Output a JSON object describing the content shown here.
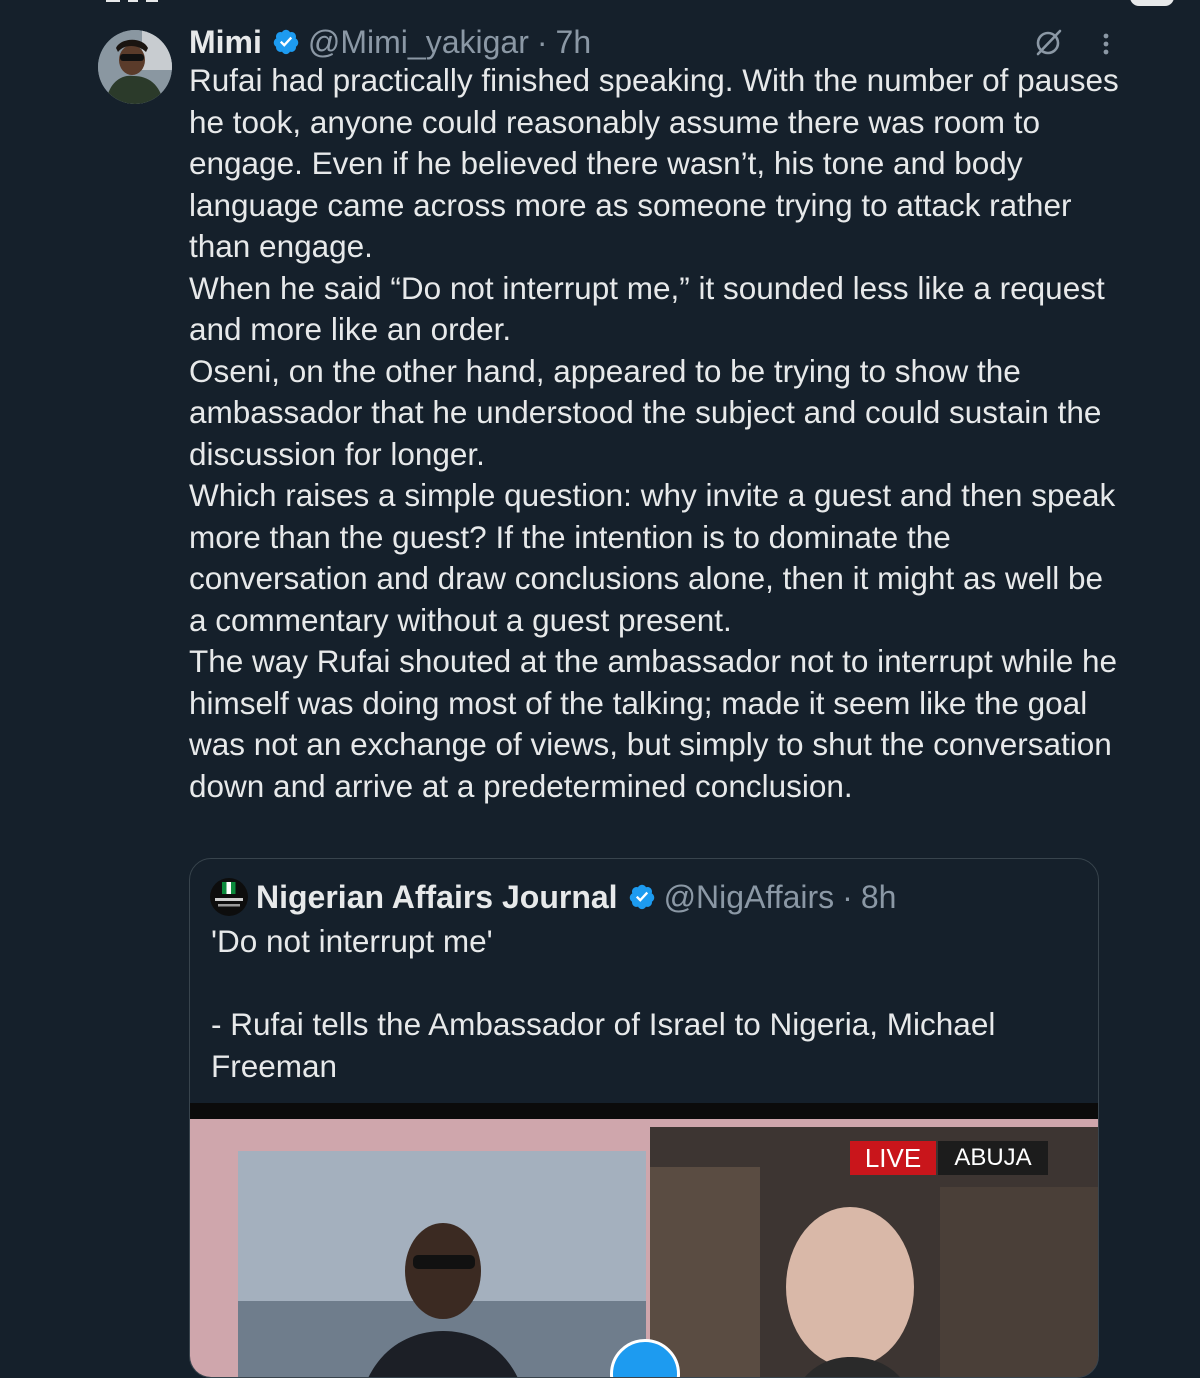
{
  "colors": {
    "background": "#15202b",
    "text": "#e7e9ea",
    "secondary_text": "#8b98a5",
    "verified_blue": "#1d9bf0",
    "border": "#38444d",
    "live_red": "#c9151b"
  },
  "tweet": {
    "author_name": "Mimi",
    "handle": "@Mimi_yakigar",
    "separator": "·",
    "time": "7h",
    "paragraphs": [
      "Rufai had practically finished speaking. With the number of pauses he took, anyone could reasonably assume there was room to engage. Even if he believed there wasn’t, his tone and body language came across more as someone trying to attack rather than engage.",
      "When he said “Do not interrupt me,” it sounded less like a request and more like an order.",
      "Oseni, on the other hand, appeared to be trying to show the ambassador that he understood the subject and could sustain the discussion for longer.",
      "Which raises a simple question: why invite a guest and then speak more than the guest? If the intention is to dominate the conversation and draw conclusions alone, then it might as well be a commentary without a guest present.",
      "The way Rufai shouted at the ambassador not to interrupt while he himself was doing most of the talking;  made it seem like the goal was not an exchange of views, but simply to shut the conversation down and arrive at a predetermined conclusion."
    ],
    "icons": {
      "avatar": "profile-photo",
      "verified": "verified-badge-icon",
      "grok": "grok-icon",
      "more": "more-options-icon"
    }
  },
  "quoted_tweet": {
    "author_name": "Nigerian Affairs Journal",
    "avatar_label": "NIGERIAN AFFAIRS",
    "handle": "@NigAffairs",
    "separator": "·",
    "time": "8h",
    "line1": "'Do not interrupt me'",
    "line2": "- Rufai tells the Ambassador of Israel to Nigeria, Michael Freeman",
    "media": {
      "live_label": "LIVE",
      "location_label": "ABUJA"
    }
  }
}
